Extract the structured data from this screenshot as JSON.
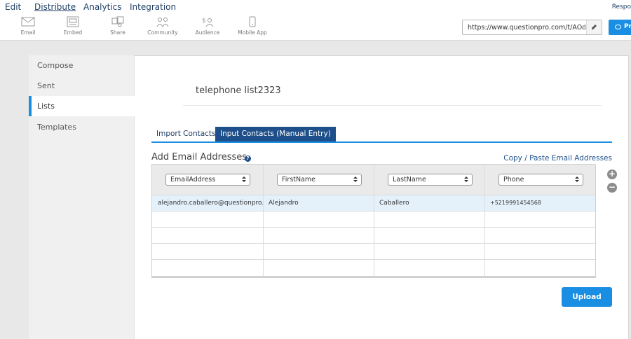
{
  "topnav": {
    "items": [
      "Edit",
      "Distribute",
      "Analytics",
      "Integration"
    ],
    "right_label": "Respo"
  },
  "toolbar": {
    "tools": [
      {
        "label": "Email",
        "icon": "envelope-icon"
      },
      {
        "label": "Embed",
        "icon": "embed-icon"
      },
      {
        "label": "Share",
        "icon": "share-icon"
      },
      {
        "label": "Community",
        "icon": "community-icon"
      },
      {
        "label": "Audience",
        "icon": "audience-icon"
      },
      {
        "label": "Mobile App",
        "icon": "mobile-icon"
      }
    ],
    "url": "https://www.questionpro.com/t/AOdmmm",
    "preview_label": "Pr"
  },
  "sidebar": {
    "items": [
      "Compose",
      "Sent",
      "Lists",
      "Templates"
    ],
    "active": "Lists"
  },
  "main": {
    "list_title": "telephone list2323",
    "tabs": [
      "Import Contacts",
      "Input Contacts (Manual Entry)"
    ],
    "active_tab": "Input Contacts (Manual Entry)",
    "heading": "Add Email Addresses",
    "help_icon": "?",
    "copy_link": "Copy / Paste Email Addresses",
    "columns": [
      "EmailAddress",
      "FirstName",
      "LastName",
      "Phone"
    ],
    "rows": [
      [
        "alejandro.caballero@questionpro.",
        "Alejandro",
        "Caballero",
        "+5219991454568"
      ],
      [
        "",
        "",
        "",
        ""
      ],
      [
        "",
        "",
        "",
        ""
      ],
      [
        "",
        "",
        "",
        ""
      ],
      [
        "",
        "",
        "",
        ""
      ]
    ],
    "add_column_symbol": "+",
    "remove_column_symbol": "−",
    "upload_label": "Upload"
  },
  "colors": {
    "accent": "#1a8ee3",
    "nav_dark": "#1e4f8a",
    "row_selected": "#e4f1fb"
  }
}
